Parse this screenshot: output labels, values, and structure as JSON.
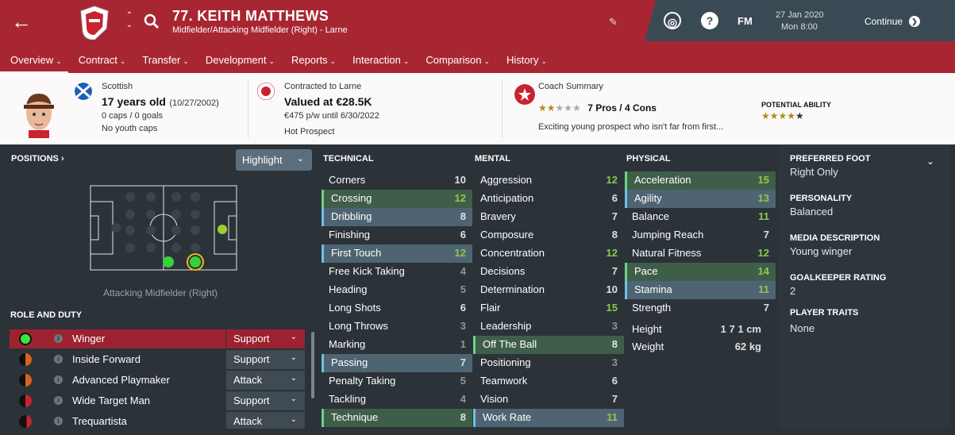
{
  "header": {
    "player_name": "77. KEITH MATTHEWS",
    "player_sub": "Midfielder/Attacking Midfielder (Right) - Larne",
    "fm_label": "FM",
    "date": "27 Jan 2020",
    "time": "Mon 8:00",
    "continue_label": "Continue"
  },
  "tabs": [
    {
      "label": "Overview"
    },
    {
      "label": "Contract"
    },
    {
      "label": "Transfer"
    },
    {
      "label": "Development"
    },
    {
      "label": "Reports"
    },
    {
      "label": "Interaction"
    },
    {
      "label": "Comparison"
    },
    {
      "label": "History"
    }
  ],
  "info": {
    "nationality": "Scottish",
    "age": "17 years old",
    "dob": "(10/27/2002)",
    "caps": "0 caps / 0 goals",
    "youth_caps": "No youth caps",
    "contract": "Contracted to Larne",
    "value": "Valued at €28.5K",
    "wage": "€475 p/w until 6/30/2022",
    "status": "Hot Prospect",
    "coach_title": "Coach Summary",
    "pros_cons": "7 Pros / 4 Cons",
    "coach_text": "Exciting young prospect who isn't far from first...",
    "potential_label": "POTENTIAL ABILITY",
    "coach_stars": 2,
    "potential_stars": 4
  },
  "positions": {
    "heading": "POSITIONS",
    "highlight_label": "Highlight",
    "position_label": "Attacking Midfielder (Right)"
  },
  "roles": {
    "heading": "ROLE AND DUTY",
    "items": [
      {
        "name": "Winger",
        "duty": "Support",
        "selected": true
      },
      {
        "name": "Inside Forward",
        "duty": "Support"
      },
      {
        "name": "Advanced Playmaker",
        "duty": "Attack"
      },
      {
        "name": "Wide Target Man",
        "duty": "Support"
      },
      {
        "name": "Trequartista",
        "duty": "Attack"
      }
    ]
  },
  "technical": {
    "heading": "TECHNICAL",
    "items": [
      {
        "name": "Corners",
        "value": "10",
        "hl": ""
      },
      {
        "name": "Crossing",
        "value": "12",
        "hl": "g"
      },
      {
        "name": "Dribbling",
        "value": "8",
        "hl": "b"
      },
      {
        "name": "Finishing",
        "value": "6",
        "hl": ""
      },
      {
        "name": "First Touch",
        "value": "12",
        "hl": "b"
      },
      {
        "name": "Free Kick Taking",
        "value": "4",
        "hl": ""
      },
      {
        "name": "Heading",
        "value": "5",
        "hl": ""
      },
      {
        "name": "Long Shots",
        "value": "6",
        "hl": ""
      },
      {
        "name": "Long Throws",
        "value": "3",
        "hl": ""
      },
      {
        "name": "Marking",
        "value": "1",
        "hl": ""
      },
      {
        "name": "Passing",
        "value": "7",
        "hl": "b"
      },
      {
        "name": "Penalty Taking",
        "value": "5",
        "hl": ""
      },
      {
        "name": "Tackling",
        "value": "4",
        "hl": ""
      },
      {
        "name": "Technique",
        "value": "8",
        "hl": "g"
      }
    ]
  },
  "mental": {
    "heading": "MENTAL",
    "items": [
      {
        "name": "Aggression",
        "value": "12",
        "hl": ""
      },
      {
        "name": "Anticipation",
        "value": "6",
        "hl": ""
      },
      {
        "name": "Bravery",
        "value": "7",
        "hl": ""
      },
      {
        "name": "Composure",
        "value": "8",
        "hl": ""
      },
      {
        "name": "Concentration",
        "value": "12",
        "hl": ""
      },
      {
        "name": "Decisions",
        "value": "7",
        "hl": ""
      },
      {
        "name": "Determination",
        "value": "10",
        "hl": ""
      },
      {
        "name": "Flair",
        "value": "15",
        "hl": ""
      },
      {
        "name": "Leadership",
        "value": "3",
        "hl": ""
      },
      {
        "name": "Off The Ball",
        "value": "8",
        "hl": "g"
      },
      {
        "name": "Positioning",
        "value": "3",
        "hl": ""
      },
      {
        "name": "Teamwork",
        "value": "6",
        "hl": ""
      },
      {
        "name": "Vision",
        "value": "7",
        "hl": ""
      },
      {
        "name": "Work Rate",
        "value": "11",
        "hl": "b"
      }
    ]
  },
  "physical": {
    "heading": "PHYSICAL",
    "items": [
      {
        "name": "Acceleration",
        "value": "15",
        "hl": "g"
      },
      {
        "name": "Agility",
        "value": "13",
        "hl": "b"
      },
      {
        "name": "Balance",
        "value": "11",
        "hl": ""
      },
      {
        "name": "Jumping Reach",
        "value": "7",
        "hl": ""
      },
      {
        "name": "Natural Fitness",
        "value": "12",
        "hl": ""
      },
      {
        "name": "Pace",
        "value": "14",
        "hl": "g"
      },
      {
        "name": "Stamina",
        "value": "11",
        "hl": "b"
      },
      {
        "name": "Strength",
        "value": "7",
        "hl": ""
      }
    ],
    "height_label": "Height",
    "height": "1 7 1 cm",
    "weight_label": "Weight",
    "weight": "62 kg"
  },
  "details": {
    "foot_label": "PREFERRED FOOT",
    "foot": "Right Only",
    "personality_label": "PERSONALITY",
    "personality": "Balanced",
    "media_label": "MEDIA DESCRIPTION",
    "media": "Young winger",
    "gk_label": "GOALKEEPER RATING",
    "gk": "2",
    "traits_label": "PLAYER TRAITS",
    "traits": "None"
  }
}
